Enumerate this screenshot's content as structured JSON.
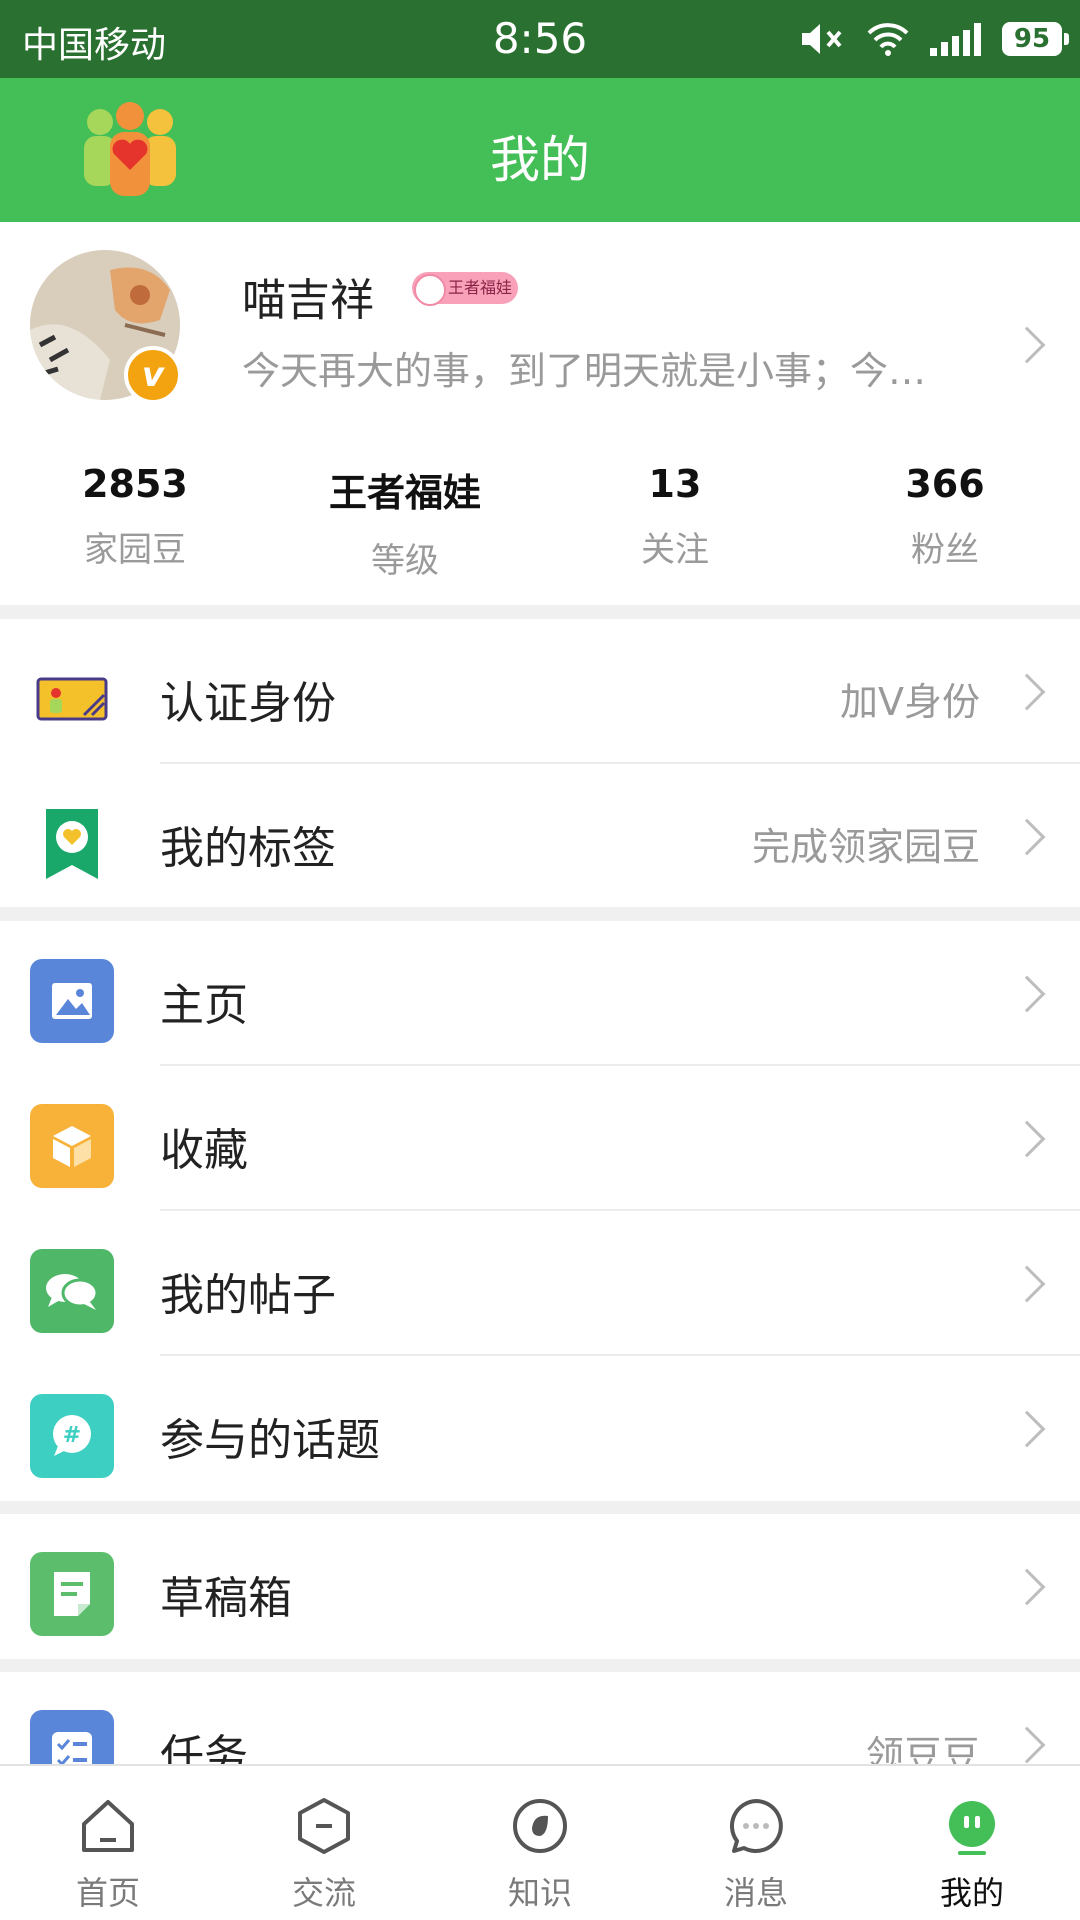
{
  "status_bar": {
    "carrier": "中国移动",
    "time": "8:56",
    "battery": "95"
  },
  "header": {
    "title": "我的"
  },
  "profile": {
    "name": "喵吉祥",
    "badge": "王者福娃",
    "signature": "今天再大的事，到了明天就是小事；今…",
    "stats": [
      {
        "value": "2853",
        "label": "家园豆"
      },
      {
        "value": "王者福娃",
        "label": "等级"
      },
      {
        "value": "13",
        "label": "关注"
      },
      {
        "value": "366",
        "label": "粉丝"
      }
    ]
  },
  "menu": {
    "verify": {
      "label": "认证身份",
      "hint": "加V身份"
    },
    "tags": {
      "label": "我的标签",
      "hint": "完成领家园豆"
    },
    "homepage": {
      "label": "主页"
    },
    "favorites": {
      "label": "收藏"
    },
    "posts": {
      "label": "我的帖子"
    },
    "topics": {
      "label": "参与的话题"
    },
    "drafts": {
      "label": "草稿箱"
    },
    "tasks": {
      "label": "任务",
      "hint": "领豆豆"
    }
  },
  "tabbar": [
    {
      "label": "首页",
      "icon": "home-icon"
    },
    {
      "label": "交流",
      "icon": "hexagon-icon"
    },
    {
      "label": "知识",
      "icon": "knowledge-icon"
    },
    {
      "label": "消息",
      "icon": "message-icon"
    },
    {
      "label": "我的",
      "icon": "me-icon",
      "active": true
    }
  ],
  "colors": {
    "status_bg": "#2a7131",
    "header_bg": "#44be56",
    "homepage_icon": "#5a86d9",
    "favorites_icon": "#f8b23a",
    "posts_icon": "#4fb768",
    "topics_icon": "#3ccfc2",
    "drafts_icon": "#5cbd6d",
    "tasks_icon": "#5a86d9",
    "active_tab": "#44be56"
  }
}
